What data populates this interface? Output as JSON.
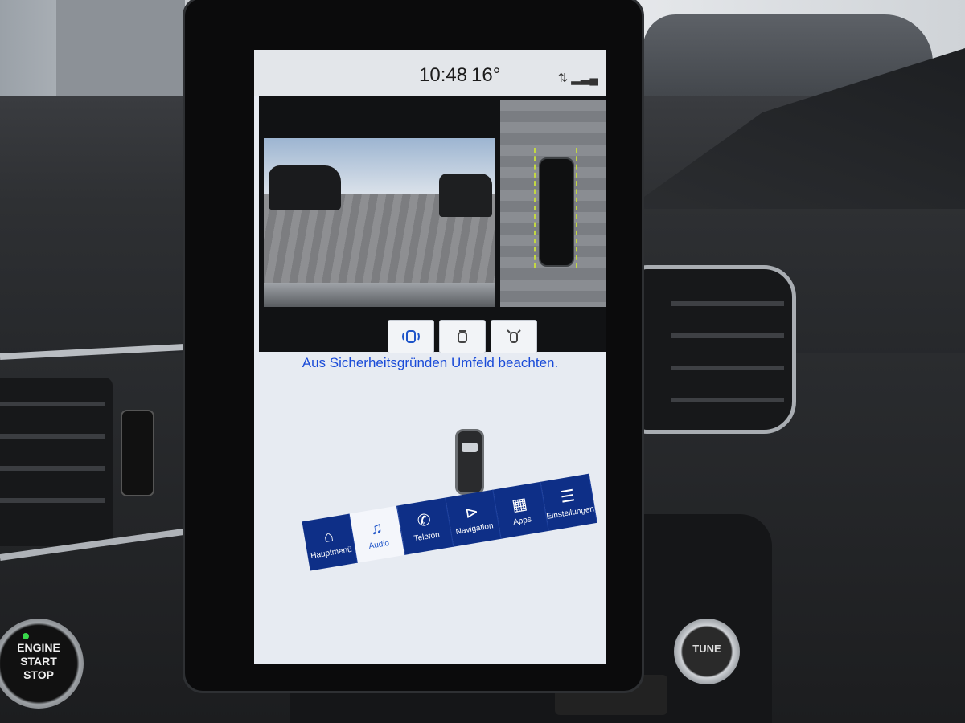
{
  "status_bar": {
    "time": "10:48",
    "temperature": "16°"
  },
  "camera_modes": [
    {
      "name": "surround-view",
      "icon": "camera-360-icon",
      "active": true
    },
    {
      "name": "rear-view",
      "icon": "car-front-icon",
      "active": false
    },
    {
      "name": "side-view",
      "icon": "car-sensors-icon",
      "active": false
    }
  ],
  "message": "Aus Sicherheitsgründen Umfeld beachten.",
  "navigation": [
    {
      "label": "Hauptmenü",
      "icon": "home-icon"
    },
    {
      "label": "Audio",
      "icon": "music-note-icon",
      "active": true
    },
    {
      "label": "Telefon",
      "icon": "phone-icon"
    },
    {
      "label": "Navigation",
      "icon": "navigation-arrow-icon"
    },
    {
      "label": "Apps",
      "icon": "apps-grid-icon"
    },
    {
      "label": "Einstellungen",
      "icon": "settings-sliders-icon"
    }
  ],
  "hardware": {
    "start_button": "ENGINE\nSTART\nSTOP",
    "tune_knob": "TUNE"
  },
  "colors": {
    "accent": "#1f55c9",
    "nav_bar": "#0e2f87",
    "message": "#1a4bd8"
  }
}
